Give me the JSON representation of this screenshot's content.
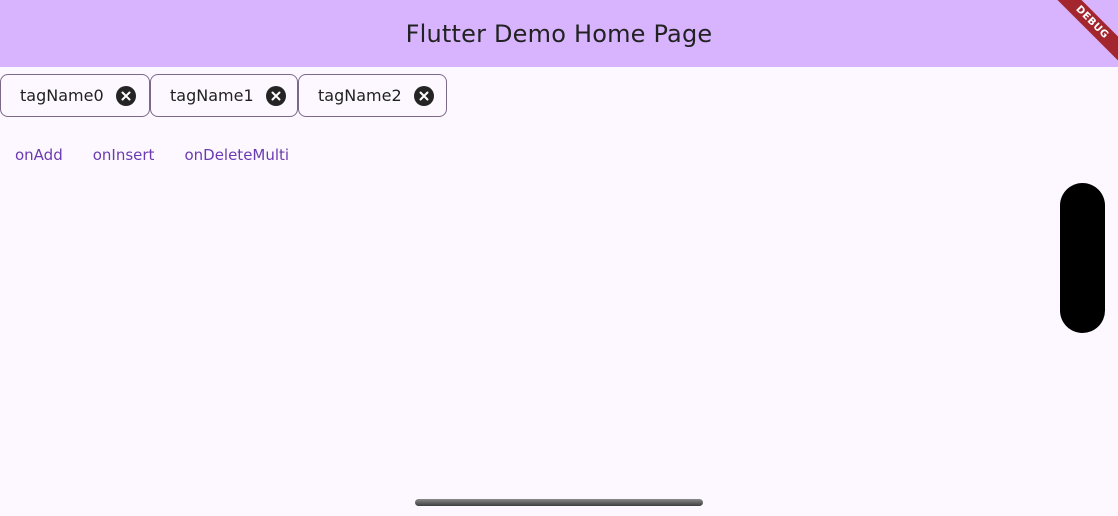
{
  "appbar": {
    "title": "Flutter Demo Home Page",
    "debug_label": "DEBUG",
    "background": "#d8b4fe"
  },
  "tags": [
    {
      "label": "tagName0",
      "delete_icon": "cancel-icon"
    },
    {
      "label": "tagName1",
      "delete_icon": "cancel-icon"
    },
    {
      "label": "tagName2",
      "delete_icon": "cancel-icon"
    }
  ],
  "actions": {
    "add": "onAdd",
    "insert": "onInsert",
    "delete_multi": "onDeleteMulti"
  },
  "colors": {
    "accent": "#6a3bb0",
    "debug_ribbon": "#a3262f",
    "page_background": "#fdf8ff"
  }
}
